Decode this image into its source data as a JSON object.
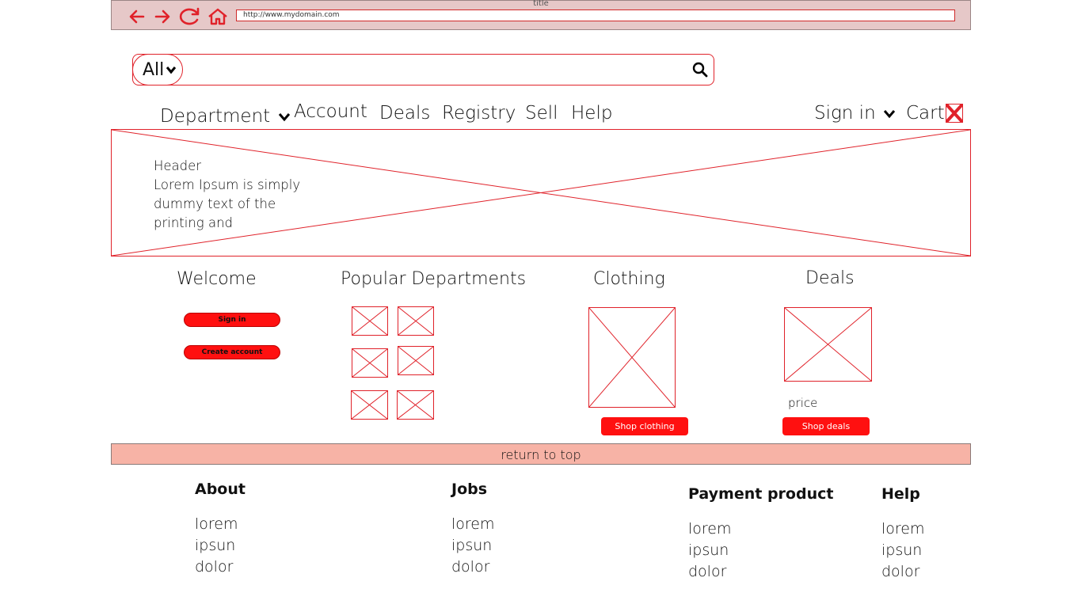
{
  "browser": {
    "title": "title",
    "url": "http://www.mydomain.com",
    "icons": [
      "back-arrow-icon",
      "forward-arrow-icon",
      "reload-icon",
      "home-icon"
    ],
    "accent": "#e0222a"
  },
  "search": {
    "category": "All",
    "value": "",
    "placeholder": ""
  },
  "nav": {
    "department": "Department",
    "account": "Account",
    "deals": "Deals",
    "registry": "Registry",
    "sell": "Sell",
    "help": "Help",
    "sign_in": "Sign in",
    "cart": "Cart"
  },
  "hero": {
    "heading": "Header",
    "body": "Lorem Ipsum is simply dummy text of the printing and"
  },
  "welcome": {
    "title": "Welcome",
    "sign_in": "Sign in",
    "create_account": "Create account"
  },
  "popular": {
    "title": "Popular Departments",
    "tile_count": 6
  },
  "clothing": {
    "title": "Clothing",
    "button": "Shop clothing"
  },
  "deals": {
    "title": "Deals",
    "price": "price",
    "button": "Shop deals"
  },
  "return_to_top": "return to top",
  "footer": {
    "columns": [
      {
        "heading": "About",
        "links": [
          "lorem",
          "ipsun",
          "dolor"
        ]
      },
      {
        "heading": "Jobs",
        "links": [
          "lorem",
          "ipsun",
          "dolor"
        ]
      },
      {
        "heading": "Payment product",
        "links": [
          "lorem",
          "ipsun",
          "dolor"
        ]
      },
      {
        "heading": "Help",
        "links": [
          "lorem",
          "ipsun",
          "dolor"
        ]
      }
    ]
  },
  "colors": {
    "chrome_bg": "#e6c8c8",
    "button_red": "#ff1010",
    "return_bar": "#f7b3a6"
  }
}
